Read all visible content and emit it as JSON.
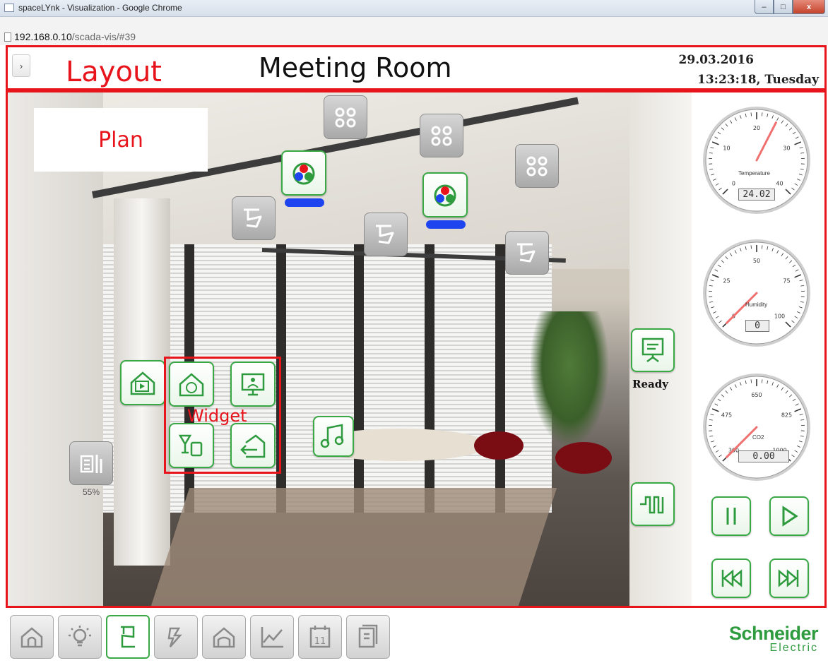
{
  "window": {
    "title": "spaceLYnk - Visualization - Google Chrome",
    "minimize": "–",
    "maximize": "□",
    "close": "x"
  },
  "address": {
    "host": "192.168.0.10",
    "path": "/scada-vis/#39"
  },
  "header": {
    "menu_toggle": "›",
    "annotation": "Layout",
    "title": "Meeting Room",
    "date": "29.03.2016",
    "time": "13:23:18, Tuesday"
  },
  "plan": {
    "annotation": "Plan"
  },
  "widget": {
    "annotation": "Widget"
  },
  "scene_widgets": {
    "rgb_lights": [
      {
        "icon": "rgb-light-icon"
      },
      {
        "icon": "rgb-light-icon"
      }
    ],
    "ceiling_speakers": 3,
    "blinds": 3,
    "status_label": "Ready",
    "dimmer_percent": "55%"
  },
  "gauges": [
    {
      "name": "Temperature",
      "value": "24.02",
      "min": 0,
      "max": 40,
      "ticks": [
        "0",
        "10",
        "20",
        "30",
        "40"
      ],
      "reading": 24.02
    },
    {
      "name": "Humidity",
      "value": "0",
      "min": 0,
      "max": 100,
      "ticks": [
        "0",
        "25",
        "50",
        "75",
        "100"
      ],
      "reading": 0
    },
    {
      "name": "CO2",
      "value": "0.00",
      "min": 300,
      "max": 1000,
      "ticks": [
        "300",
        "475",
        "650",
        "825",
        "1000"
      ],
      "reading": 300
    }
  ],
  "media": {
    "pause": "pause-icon",
    "play": "play-icon",
    "prev": "previous-icon",
    "next": "next-icon"
  },
  "bottom_nav": {
    "items": [
      "home-icon",
      "lighting-icon",
      "blinds-icon",
      "energy-icon",
      "garage-icon",
      "trends-icon",
      "calendar-icon",
      "logbook-icon"
    ],
    "calendar_day": "11",
    "active_index": 2
  },
  "brand": {
    "line1": "Schneider",
    "line2": "Electric"
  },
  "colors": {
    "annotation_red": "#e8141c",
    "widget_green": "#39a845",
    "brand_green": "#2e9b3e",
    "rgb_bar_blue": "#1e44f0"
  }
}
